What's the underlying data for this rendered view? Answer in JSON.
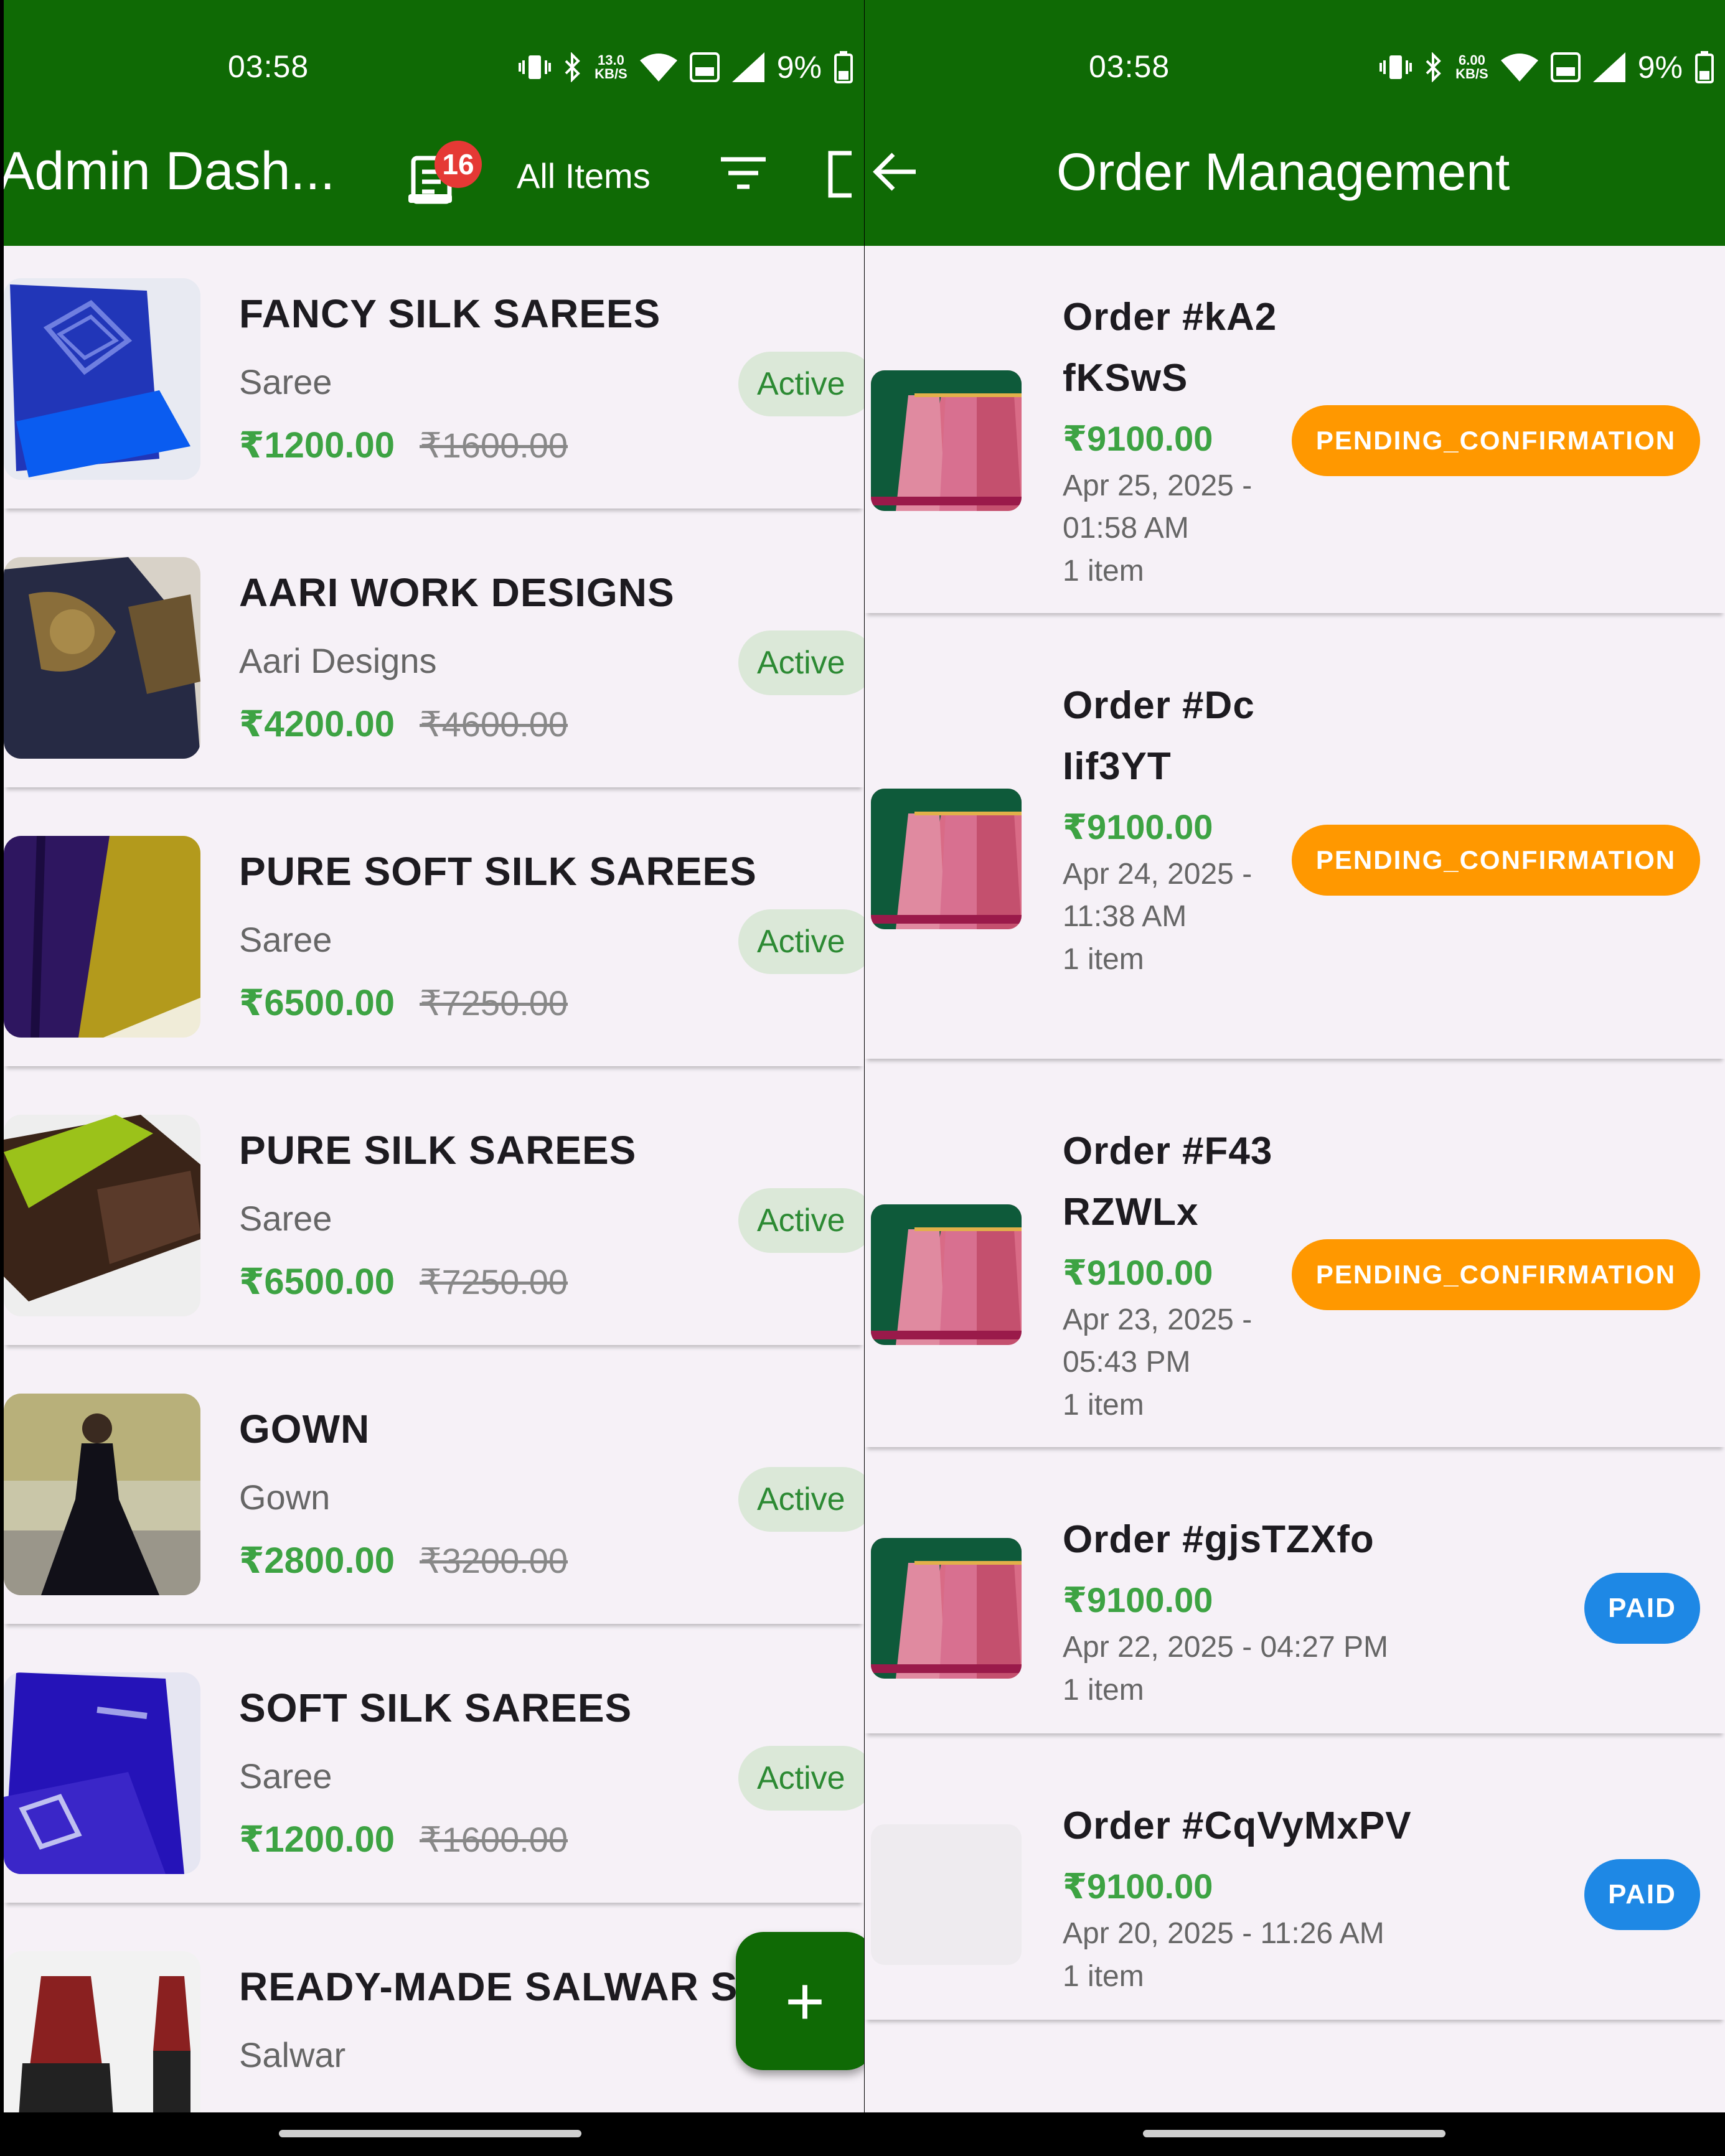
{
  "left": {
    "status": {
      "time": "03:58",
      "net_speed_top": "13.0",
      "net_speed_unit": "KB/S",
      "battery": "9%"
    },
    "app_bar": {
      "title": "Admin Dash...",
      "cart_badge": "16",
      "filter_label": "All Items"
    },
    "products": [
      {
        "name": "FANCY SILK SAREES",
        "category": "Saree",
        "price": "₹1200.00",
        "original_price": "₹1600.00",
        "status": "Active"
      },
      {
        "name": "AARI WORK DESIGNS",
        "category": "Aari Designs",
        "price": "₹4200.00",
        "original_price": "₹4600.00",
        "status": "Active"
      },
      {
        "name": "PURE SOFT SILK SAREES",
        "category": "Saree",
        "price": "₹6500.00",
        "original_price": "₹7250.00",
        "status": "Active"
      },
      {
        "name": "PURE SILK SAREES",
        "category": "Saree",
        "price": "₹6500.00",
        "original_price": "₹7250.00",
        "status": "Active"
      },
      {
        "name": "GOWN",
        "category": "Gown",
        "price": "₹2800.00",
        "original_price": "₹3200.00",
        "status": "Active"
      },
      {
        "name": "SOFT SILK SAREES",
        "category": "Saree",
        "price": "₹1200.00",
        "original_price": "₹1600.00",
        "status": "Active"
      },
      {
        "name": "READY-MADE SALWAR S...",
        "category": "Salwar"
      }
    ],
    "fab_label": "+"
  },
  "right": {
    "status": {
      "time": "03:58",
      "net_speed_top": "6.00",
      "net_speed_unit": "KB/S",
      "battery": "9%"
    },
    "app_bar": {
      "title": "Order Management"
    },
    "orders": [
      {
        "id": "Order #kA2fKSwS",
        "price": "₹9100.00",
        "date": "Apr 25, 2025 - 01:58 AM",
        "items": "1 item",
        "status": "PENDING_CONFIRMATION"
      },
      {
        "id": "Order #DcIif3YT",
        "price": "₹9100.00",
        "date": "Apr 24, 2025 - 11:38 AM",
        "items": "1 item",
        "status": "PENDING_CONFIRMATION"
      },
      {
        "id": "Order #F43RZWLx",
        "price": "₹9100.00",
        "date": "Apr 23, 2025 - 05:43 PM",
        "items": "1 item",
        "status": "PENDING_CONFIRMATION"
      },
      {
        "id": "Order #gjsTZXfo",
        "price": "₹9100.00",
        "date": "Apr 22, 2025 - 04:27 PM",
        "items": "1 item",
        "status": "PAID"
      },
      {
        "id": "Order #CqVyMxPV",
        "price": "₹9100.00",
        "date": "Apr 20, 2025 - 11:26 AM",
        "items": "1 item",
        "status": "PAID"
      }
    ]
  },
  "colors": {
    "header_green": "#0f6a05",
    "price_green": "#3da343",
    "pending_orange": "#ff9800",
    "paid_blue": "#1e88e5",
    "badge_red": "#e53935"
  },
  "icons": [
    "vibrate-icon",
    "bluetooth-icon",
    "wifi-icon",
    "volte-icon",
    "signal-icon",
    "battery-icon",
    "cart-icon",
    "filter-icon",
    "logout-icon",
    "back-arrow-icon",
    "add-icon"
  ]
}
